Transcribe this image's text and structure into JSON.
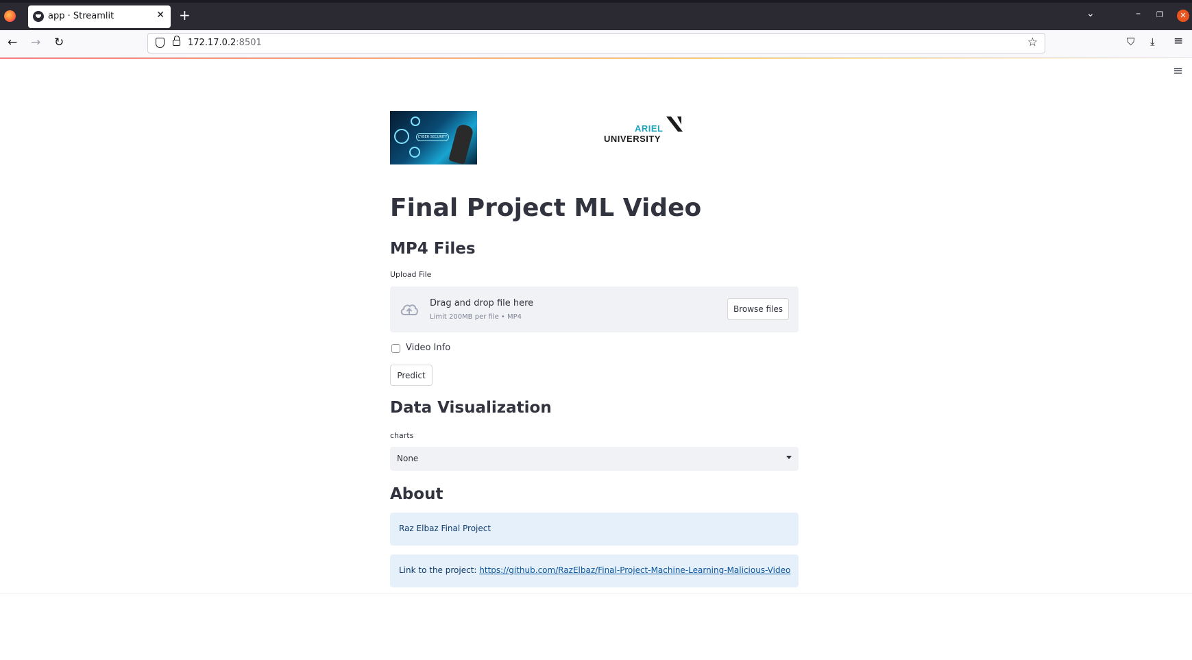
{
  "browser": {
    "tab_title": "app · Streamlit",
    "tab_close": "✕",
    "new_tab": "+",
    "url_host": "172.17.0.2",
    "url_port": ":8501",
    "back": "←",
    "forward": "→",
    "reload": "↻",
    "star": "☆",
    "pocket": "⛉",
    "download": "⤓",
    "menu": "≡",
    "tab_list": "⌄",
    "minimize": "–",
    "maximize": "❐",
    "close": "✕"
  },
  "page": {
    "menu_icon": "≡",
    "logos": {
      "cyber_label": "CYBER SECURITY",
      "ariel": "ARIEL",
      "university": "UNIVERSITY"
    },
    "title": "Final Project ML Video",
    "mp4_header": "MP4 Files",
    "upload_label": "Upload File",
    "dropzone_title": "Drag and drop file here",
    "dropzone_sub": "Limit 200MB per file • MP4",
    "browse_button": "Browse files",
    "checkbox_label": "Video Info",
    "predict_button": "Predict",
    "dataviz_header": "Data Visualization",
    "charts_label": "charts",
    "charts_selected": "None",
    "about_header": "About",
    "about_text": "Raz Elbaz Final Project",
    "link_prefix": "Link to the project: ",
    "link_url": "https://github.com/RazElbaz/Final-Project-Machine-Learning-Malicious-Video"
  }
}
